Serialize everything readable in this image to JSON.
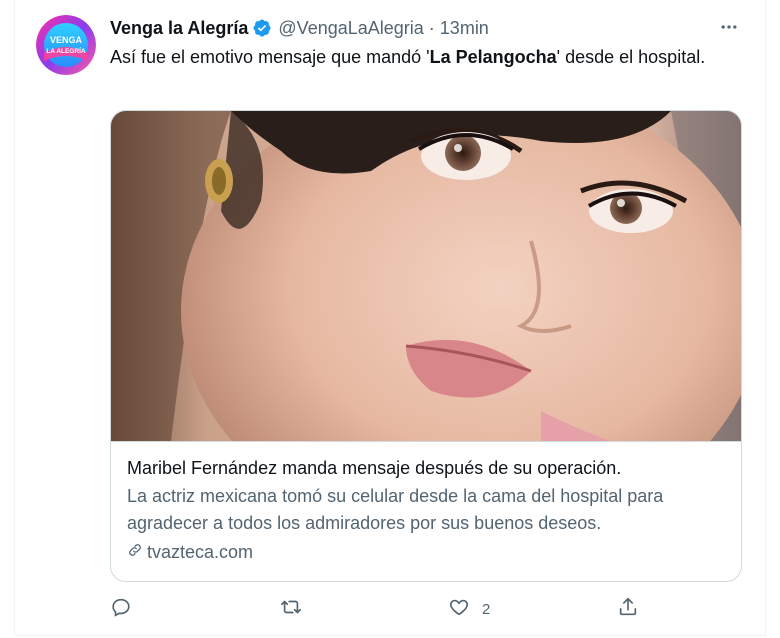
{
  "tweet": {
    "author": {
      "display_name": "Venga la Alegría",
      "handle": "@VengaLaAlegria",
      "avatar_text_top": "VENGA",
      "avatar_text_bottom": "LA ALEGRÍA",
      "verified": true
    },
    "separator": "·",
    "time": "13min",
    "text_before": "Así fue el emotivo mensaje que mandó '",
    "text_bold": "La Pelangocha",
    "text_after": "' desde el hospital."
  },
  "card": {
    "title": "Maribel Fernández manda mensaje después de su operación.",
    "description": "La actriz mexicana tomó su celular desde la cama del hospital para agradecer a todos los admiradores por sus buenos deseos.",
    "domain": "tvazteca.com"
  },
  "actions": {
    "reply_count": "",
    "retweet_count": "",
    "like_count": "2",
    "share_count": ""
  },
  "colors": {
    "text_primary": "#0f1419",
    "text_secondary": "#536471",
    "verified_blue": "#1d9bf0",
    "border": "#cfd9de"
  },
  "icons": [
    "more-icon",
    "verified-icon",
    "link-icon",
    "reply-icon",
    "retweet-icon",
    "like-icon",
    "share-icon"
  ]
}
